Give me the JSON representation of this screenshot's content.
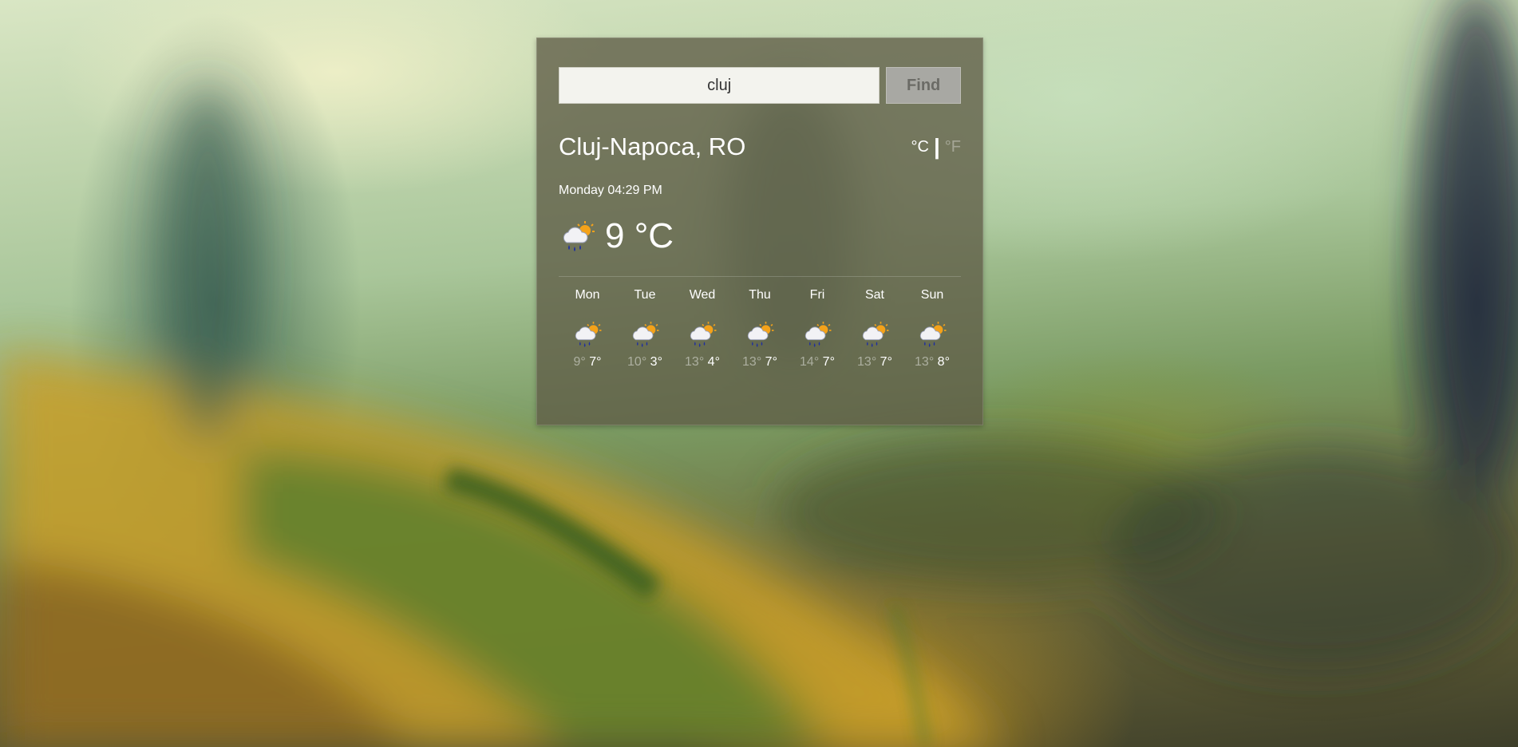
{
  "search": {
    "value": "cluj",
    "button_label": "Find"
  },
  "location": {
    "city": "Cluj-Napoca, RO"
  },
  "units": {
    "celsius": "°C",
    "separator": "|",
    "fahrenheit": "°F",
    "active": "celsius"
  },
  "current": {
    "datetime": "Monday 04:29 PM",
    "temperature": "9 °C",
    "icon": "rain-cloud-sun-icon"
  },
  "forecast": [
    {
      "day": "Mon",
      "high": "9°",
      "low": "7°",
      "icon": "rain-cloud-sun-icon"
    },
    {
      "day": "Tue",
      "high": "10°",
      "low": "3°",
      "icon": "rain-cloud-sun-icon"
    },
    {
      "day": "Wed",
      "high": "13°",
      "low": "4°",
      "icon": "rain-cloud-sun-icon"
    },
    {
      "day": "Thu",
      "high": "13°",
      "low": "7°",
      "icon": "rain-cloud-sun-icon"
    },
    {
      "day": "Fri",
      "high": "14°",
      "low": "7°",
      "icon": "rain-cloud-sun-icon"
    },
    {
      "day": "Sat",
      "high": "13°",
      "low": "7°",
      "icon": "rain-cloud-sun-icon"
    },
    {
      "day": "Sun",
      "high": "13°",
      "low": "8°",
      "icon": "rain-cloud-sun-icon"
    }
  ]
}
